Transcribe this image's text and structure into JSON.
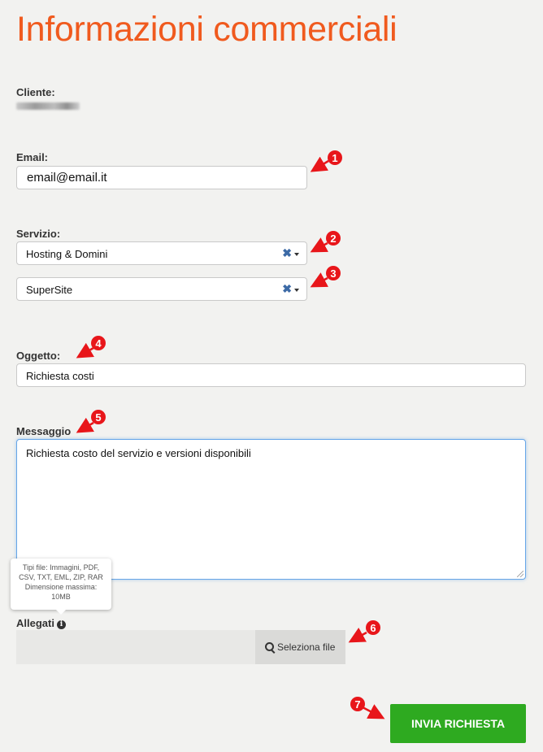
{
  "page": {
    "title": "Informazioni commerciali"
  },
  "form": {
    "client_label": "Cliente:",
    "email_label": "Email:",
    "email_value": "email@email.it",
    "service_label": "Servizio:",
    "service_value": "Hosting & Domini",
    "subservice_value": "SuperSite",
    "clear_symbol": "✖",
    "subject_label": "Oggetto:",
    "subject_value": "Richiesta costi",
    "message_label": "Messaggio",
    "message_value": "Richiesta costo del servizio e versioni disponibili",
    "attachments_label": "Allegati",
    "attachments_tooltip": [
      "Tipi file: Immagini, PDF,",
      "CSV, TXT, EML, ZIP, RAR",
      "Dimensione massima:",
      "10MB"
    ],
    "select_file_label": "Seleziona file",
    "submit_label": "INVIA RICHIESTA"
  },
  "annotations": {
    "color": "#e8161a",
    "markers": [
      "1",
      "2",
      "3",
      "4",
      "5",
      "6",
      "7"
    ]
  }
}
